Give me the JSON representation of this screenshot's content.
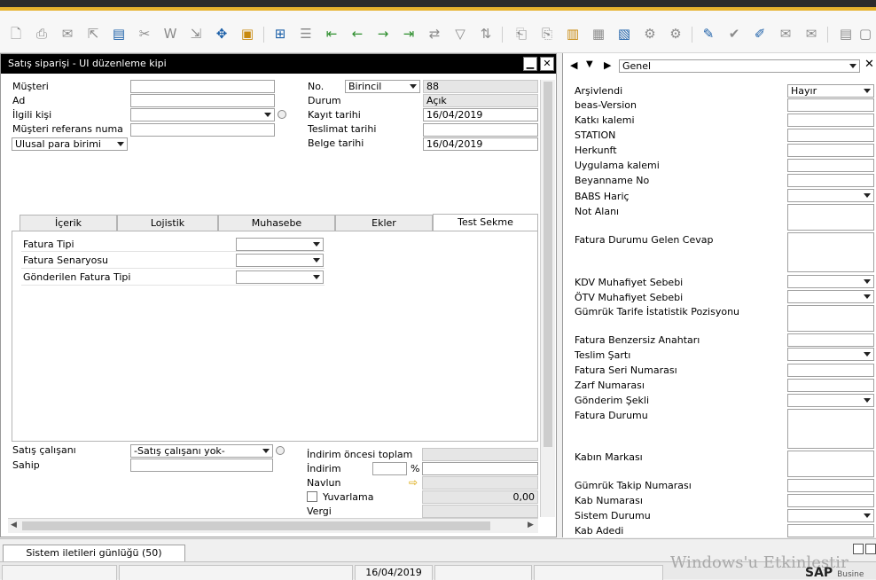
{
  "form": {
    "title": "Satış siparişi - UI düzenleme kipi",
    "fields": {
      "musteri": "Müşteri",
      "ad": "Ad",
      "ilgili_kisi": "İlgili kişi",
      "musteri_ref": "Müşteri referans numa",
      "para_birimi": "Ulusal para birimi",
      "no_label": "No.",
      "no_series": "Birincil",
      "no_value": "88",
      "durum_label": "Durum",
      "durum_value": "Açık",
      "kayit_label": "Kayıt tarihi",
      "kayit_value": "16/04/2019",
      "teslimat_label": "Teslimat tarihi",
      "belge_label": "Belge tarihi",
      "belge_value": "16/04/2019"
    },
    "tabs": [
      "İçerik",
      "Lojistik",
      "Muhasebe",
      "Ekler",
      "Test Sekme"
    ],
    "tab_fields": [
      "Fatura Tipi",
      "Fatura Senaryosu",
      "Gönderilen Fatura Tipi"
    ],
    "bottom": {
      "satis_calisani": "Satış çalışanı",
      "satis_calisani_value": "-Satış çalışanı yok-",
      "sahip": "Sahip",
      "indirim_oncesi": "İndirim öncesi toplam",
      "indirim": "İndirim",
      "percent": "%",
      "navlun": "Navlun",
      "yuvarlama": "Yuvarlama",
      "yuvarlama_value": "0,00",
      "vergi": "Vergi"
    }
  },
  "right_panel": {
    "header": "Genel",
    "fields": [
      {
        "label": "Arşivlendi",
        "value": "Hayır"
      },
      {
        "label": "beas-Version"
      },
      {
        "label": "Katkı kalemi"
      },
      {
        "label": "STATION"
      },
      {
        "label": "Herkunft"
      },
      {
        "label": "Uygulama kalemi"
      },
      {
        "label": "Beyanname No"
      },
      {
        "label": "BABS Hariç"
      },
      {
        "label": "Not Alanı"
      },
      {
        "label": "Fatura Durumu Gelen Cevap"
      },
      {
        "label": "KDV Muhafiyet Sebebi"
      },
      {
        "label": "ÖTV Muhafiyet Sebebi"
      },
      {
        "label": "Gümrük Tarife İstatistik Pozisyonu"
      },
      {
        "label": "Fatura Benzersiz Anahtarı"
      },
      {
        "label": "Teslim Şartı"
      },
      {
        "label": "Fatura Seri Numarası"
      },
      {
        "label": "Zarf Numarası"
      },
      {
        "label": "Gönderim Şekli"
      },
      {
        "label": "Fatura Durumu"
      },
      {
        "label": "Kabın Markası"
      },
      {
        "label": "Gümrük Takip Numarası"
      },
      {
        "label": "Kab Numarası"
      },
      {
        "label": "Sistem Durumu"
      },
      {
        "label": "Kab Adedi"
      }
    ]
  },
  "bottom_bar": {
    "messages_tab": "Sistem iletileri günlüğü (50)",
    "status_date": "16/04/2019",
    "watermark": "Windows'u Etkinleştir",
    "sap_logo": "SAP",
    "sap_sub": "Busine"
  },
  "icons": [
    "new-document-icon",
    "print-icon",
    "email-icon",
    "export-icon",
    "print-preview-icon",
    "delete-icon",
    "word-icon",
    "pdf-icon",
    "move-icon",
    "lock-icon",
    "find-icon",
    "list-icon",
    "first-record-icon",
    "previous-record-icon",
    "next-record-icon",
    "last-record-icon",
    "refresh-icon",
    "filter-icon",
    "sort-icon",
    "copy-from-icon",
    "copy-to-icon",
    "report-icon",
    "calendar-icon",
    "chart-icon",
    "settings-icon",
    "edit-icon",
    "check-icon",
    "notes-icon",
    "message-icon",
    "window-icon"
  ],
  "colors": {
    "accent_gold": "#e6b22e",
    "title_black": "#000000",
    "field_border": "#a0a0a0",
    "readonly_bg": "#e6e6e6"
  }
}
